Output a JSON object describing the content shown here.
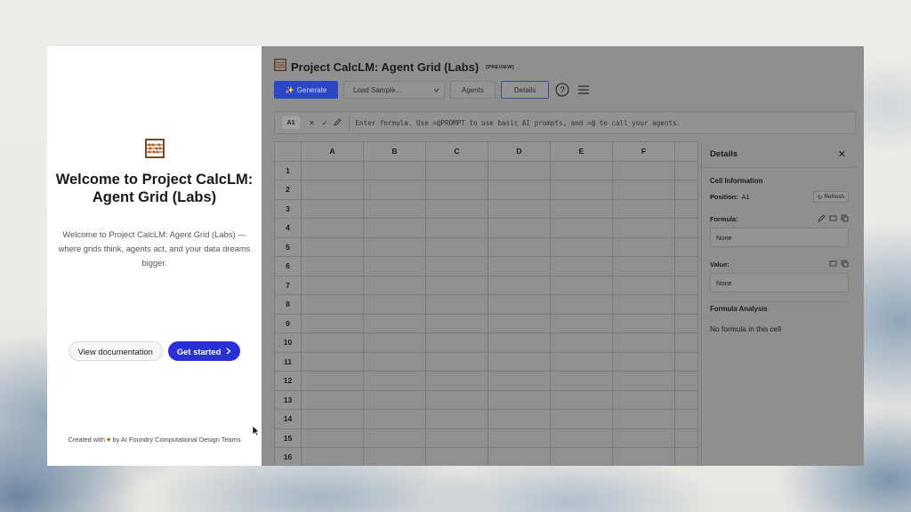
{
  "welcome": {
    "logo_icon": "abacus-icon",
    "title": "Welcome to Project CalcLM: Agent Grid (Labs)",
    "description": "Welcome to Project CalcLM: Agent Grid (Labs) — where grids think, agents act, and your data dreams bigger.",
    "view_docs_label": "View documentation",
    "get_started_label": "Get started",
    "footer_prefix": "Created with",
    "footer_suffix": "by AI Foundry Computational Design Teams",
    "accent_color": "#2b2fd6"
  },
  "app": {
    "title": "Project CalcLM: Agent Grid (Labs)",
    "badge": "[PREVIEW]",
    "toolbar": {
      "generate_label": "Generate",
      "load_sample_label": "Load Sample...",
      "agents_label": "Agents",
      "details_label": "Details"
    },
    "formula_bar": {
      "cell_ref": "A1",
      "placeholder": "Enter formula. Use =@PROMPT to use basic AI prompts, and =@ to call your agents."
    },
    "grid": {
      "columns": [
        "A",
        "B",
        "C",
        "D",
        "E",
        "F"
      ],
      "rows": [
        "1",
        "2",
        "3",
        "4",
        "5",
        "6",
        "7",
        "8",
        "9",
        "10",
        "11",
        "12",
        "13",
        "14",
        "15",
        "16"
      ]
    },
    "details": {
      "title": "Details",
      "cell_info_heading": "Cell Information",
      "position_label": "Position:",
      "position_value": "A1",
      "refresh_label": "Refresh",
      "formula_label": "Formula:",
      "formula_value": "None",
      "value_label": "Value:",
      "value_value": "None",
      "analysis_heading": "Formula Analysis",
      "analysis_text": "No formula in this cell"
    }
  }
}
